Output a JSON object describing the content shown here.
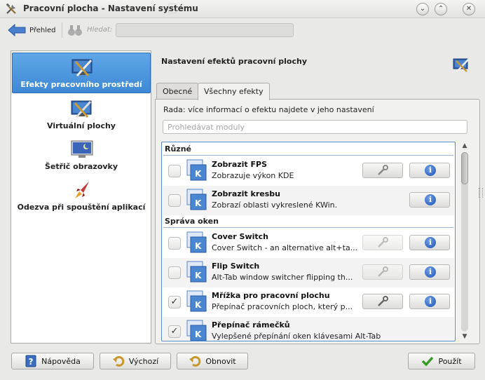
{
  "window": {
    "title": "Pracovní plocha - Nastavení systému"
  },
  "toolbar": {
    "back_label": "Přehled",
    "search_label": "Hledat:",
    "search_value": ""
  },
  "categories": [
    {
      "label": "Efekty pracovního prostředí",
      "icon": "desktop-effects-icon",
      "selected": true
    },
    {
      "label": "Virtuální plochy",
      "icon": "virtual-desktops-icon",
      "selected": false
    },
    {
      "label": "Šetřič obrazovky",
      "icon": "screensaver-icon",
      "selected": false
    },
    {
      "label": "Odezva při spouštění aplikací",
      "icon": "launch-feedback-icon",
      "selected": false
    }
  ],
  "main": {
    "heading": "Nastavení efektů pracovní plochy",
    "tabs": [
      {
        "label": "Obecné",
        "active": false
      },
      {
        "label": "Všechny efekty",
        "active": true
      }
    ],
    "hint": "Rada: více informací o efektu najdete v jeho nastavení",
    "filter_placeholder": "Prohledávat moduly"
  },
  "effect_groups": [
    {
      "name": "Různé",
      "effects": [
        {
          "name": "Zobrazit FPS",
          "description": "Zobrazuje výkon KDE",
          "checked": false,
          "configurable": true
        },
        {
          "name": "Zobrazit kresbu",
          "description": "Zobrazí oblasti vykreslené KWin.",
          "checked": false,
          "configurable": false
        }
      ]
    },
    {
      "name": "Správa oken",
      "effects": [
        {
          "name": "Cover Switch",
          "description": "Cover Switch - an alternative alt+ta...",
          "checked": false,
          "configurable": true
        },
        {
          "name": "Flip Switch",
          "description": "Alt-Tab window switcher flipping th...",
          "checked": false,
          "configurable": true
        },
        {
          "name": "Mřížka pro pracovní plochu",
          "description": "Přepínač pracovních ploch, který p...",
          "checked": true,
          "configurable": true
        },
        {
          "name": "Přepínač rámečků",
          "description": "Vylepšené přepínání oken klávesami Alt-Tab",
          "checked": true,
          "configurable": true
        }
      ]
    }
  ],
  "buttons": {
    "help": "Nápověda",
    "defaults": "Výchozí",
    "reset": "Obnovit",
    "apply": "Použít"
  },
  "colors": {
    "selection": "#3f88d6",
    "info": "#1d4fb4",
    "list_border": "#5a8fc9"
  }
}
